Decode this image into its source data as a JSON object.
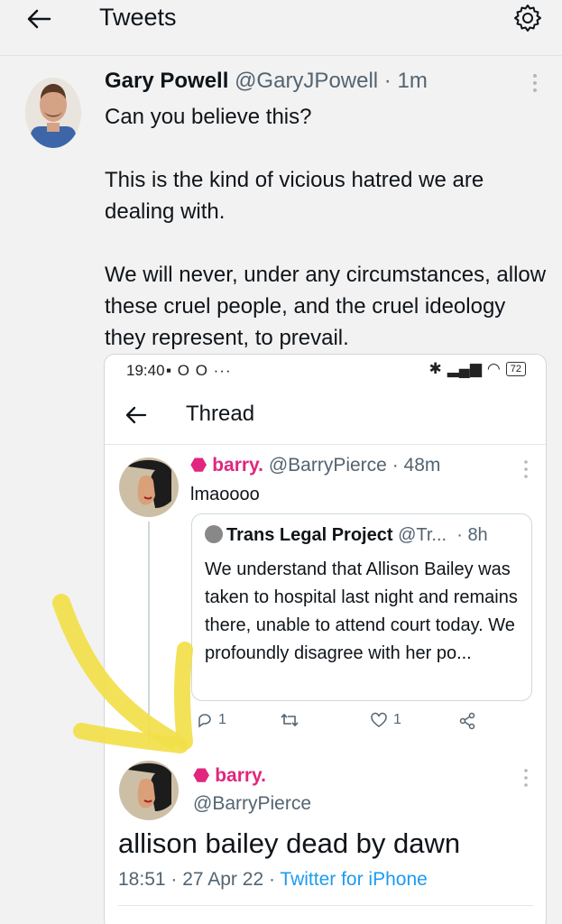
{
  "topbar": {
    "title": "Tweets"
  },
  "outer_tweet": {
    "name": "Gary Powell",
    "handle": "@GaryJPowell",
    "sep": " · ",
    "time": "1m",
    "paragraphs": [
      "Can you believe this?",
      "This is the kind of vicious hatred we are dealing with.",
      "We will never, under any circumstances, allow these cruel people, and the cruel ideology they represent, to prevail."
    ]
  },
  "embedded": {
    "status": {
      "time": "19:40",
      "icons": "▪ O O  ···",
      "battery": "72"
    },
    "thread_title": "Thread",
    "reply_tweet": {
      "name": "barry.",
      "handle": "@BarryPierce",
      "time": "48m",
      "text": "lmaoooo"
    },
    "quote": {
      "name": "Trans Legal Project",
      "handle": "@Tr...",
      "time": "8h",
      "text": "We understand that Allison Bailey was taken to hospital last night and remains there, unable to attend court today. We profoundly disagree with her po..."
    },
    "actions": {
      "replies": "1",
      "likes": "1"
    },
    "main_tweet": {
      "name": "barry.",
      "handle": "@BarryPierce",
      "text": "allison bailey dead by dawn",
      "date": "18:51 · 27 Apr 22 · ",
      "source": "Twitter for iPhone"
    }
  },
  "colors": {
    "accent_pink": "#e0267e",
    "link_blue": "#1d9bf0",
    "highlight_yellow": "#f2e04a"
  }
}
